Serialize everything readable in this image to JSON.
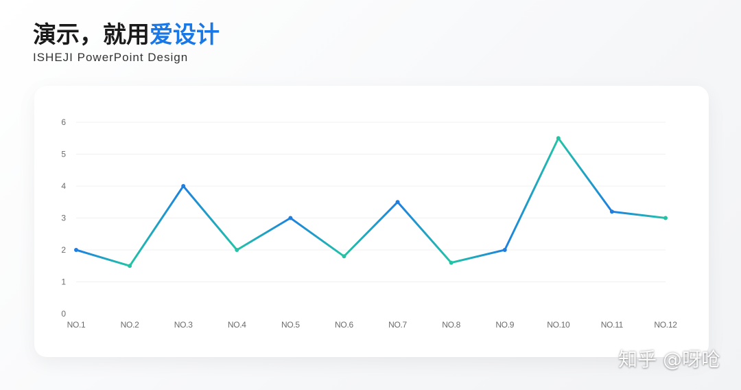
{
  "header": {
    "title_main": "演示，就用",
    "title_accent": "爱设计",
    "subtitle": "ISHEJI PowerPoint Design"
  },
  "watermark": "知乎 @呀呛",
  "colors": {
    "accent": "#1a78e6",
    "line_blue": "#1e7fe0",
    "line_teal": "#23c4a6",
    "grid": "#f0f0f0",
    "tick": "#6b6b6b"
  },
  "chart_data": {
    "type": "line",
    "categories": [
      "NO.1",
      "NO.2",
      "NO.3",
      "NO.4",
      "NO.5",
      "NO.6",
      "NO.7",
      "NO.8",
      "NO.9",
      "NO.10",
      "NO.11",
      "NO.12"
    ],
    "series": [
      {
        "values": [
          2,
          1.5,
          4,
          2,
          3,
          1.8,
          3.5,
          1.6,
          2,
          5.5,
          3.2,
          3
        ]
      }
    ],
    "ylim": [
      0,
      6
    ],
    "yticks": [
      0,
      1,
      2,
      3,
      4,
      5,
      6
    ],
    "title": "",
    "xlabel": "",
    "ylabel": "",
    "grid": true,
    "legend": "none"
  }
}
